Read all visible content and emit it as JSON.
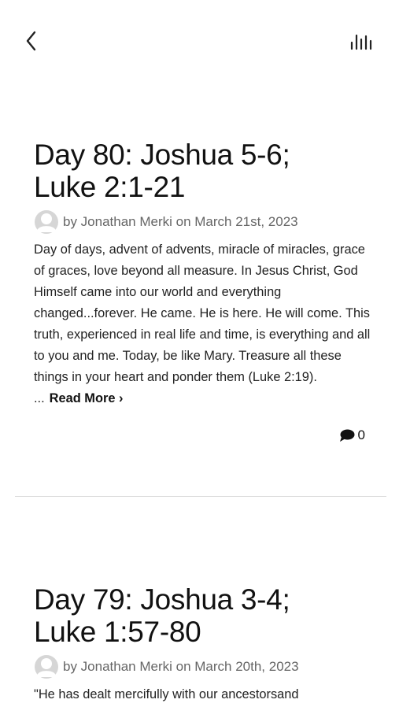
{
  "nav": {
    "back_icon": "chevron-left-icon",
    "menu_icon": "bars-icon"
  },
  "posts": [
    {
      "title_line1": "Day 80: Joshua 5-6;",
      "title_line2": "Luke 2:1-21",
      "meta": "by Jonathan Merki on March 21st, 2023",
      "excerpt": "Day of days, advent of advents, miracle of miracles, grace of graces, love beyond all measure. In Jesus Christ, God Himself came into our world and everything changed...forever. He came. He is here. He will come. This truth, experienced in real life and time, is everything and all to you and me. Today, be like Mary. Treasure all these things in your heart and ponder them (Luke 2:19). ...",
      "read_more": "Read More ›",
      "comment_count": "0"
    },
    {
      "title_line1": "Day 79: Joshua 3-4;",
      "title_line2": "Luke 1:57-80",
      "meta": "by Jonathan Merki on March 20th, 2023",
      "excerpt": "\"He has dealt mercifully with our ancestorsand"
    }
  ]
}
